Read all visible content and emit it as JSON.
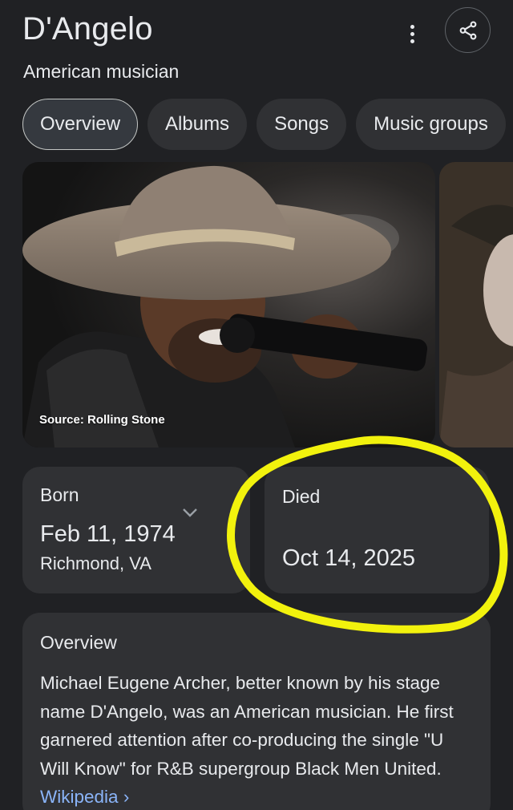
{
  "header": {
    "title": "D'Angelo",
    "subtitle": "American musician",
    "more_icon": "more-vert-icon",
    "share_icon": "share-icon"
  },
  "tabs": [
    {
      "label": "Overview",
      "active": true
    },
    {
      "label": "Albums",
      "active": false
    },
    {
      "label": "Songs",
      "active": false
    },
    {
      "label": "Music groups",
      "active": false
    }
  ],
  "media": {
    "source_caption": "Source: Rolling Stone"
  },
  "facts": {
    "born": {
      "label": "Born",
      "date": "Feb 11, 1974",
      "place": "Richmond, VA"
    },
    "died": {
      "label": "Died",
      "date": "Oct 14, 2025"
    }
  },
  "overview": {
    "label": "Overview",
    "text": "Michael Eugene Archer, better known by his stage name D'Angelo, was an American musician. He first garnered attention after co-producing the single \"U Will Know\" for R&B supergroup Black Men United.",
    "link_text": "Wikipedia",
    "link_chevron": "›"
  },
  "colors": {
    "background": "#202124",
    "card": "#303134",
    "link": "#8ab4f8",
    "highlight": "#f2f20d"
  }
}
